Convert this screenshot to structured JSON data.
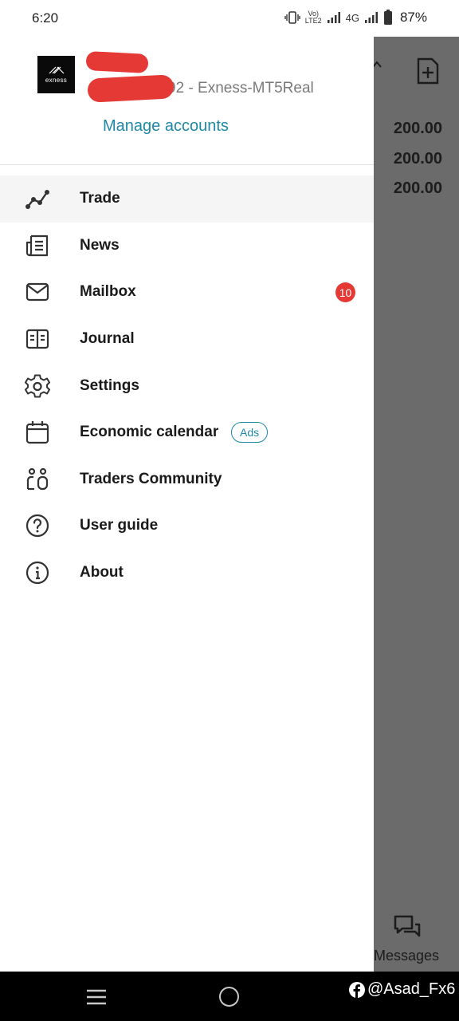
{
  "status_bar": {
    "time": "6:20",
    "volte_top": "Vo)",
    "volte_bottom": "LTE2",
    "network": "4G",
    "battery_percent": "87%"
  },
  "background_app": {
    "values": [
      "200.00",
      "200.00",
      "200.00"
    ],
    "messages_label": "Messages"
  },
  "drawer": {
    "logo_text": "exness",
    "account_server": "92 - Exness-MT5Real",
    "manage_accounts_label": "Manage accounts",
    "menu": [
      {
        "label": "Trade",
        "icon": "trade-chart-icon",
        "active": true
      },
      {
        "label": "News",
        "icon": "news-icon"
      },
      {
        "label": "Mailbox",
        "icon": "mail-icon",
        "badge": "10"
      },
      {
        "label": "Journal",
        "icon": "journal-icon"
      },
      {
        "label": "Settings",
        "icon": "gear-icon"
      },
      {
        "label": "Economic calendar",
        "icon": "calendar-icon",
        "pill": "Ads"
      },
      {
        "label": "Traders Community",
        "icon": "community-icon"
      },
      {
        "label": "User guide",
        "icon": "help-icon"
      },
      {
        "label": "About",
        "icon": "info-icon"
      }
    ]
  },
  "watermark": "@Asad_Fx6",
  "colors": {
    "accent": "#1e88a8",
    "badge": "#e53935",
    "dim_overlay": "#6b6b6b"
  }
}
